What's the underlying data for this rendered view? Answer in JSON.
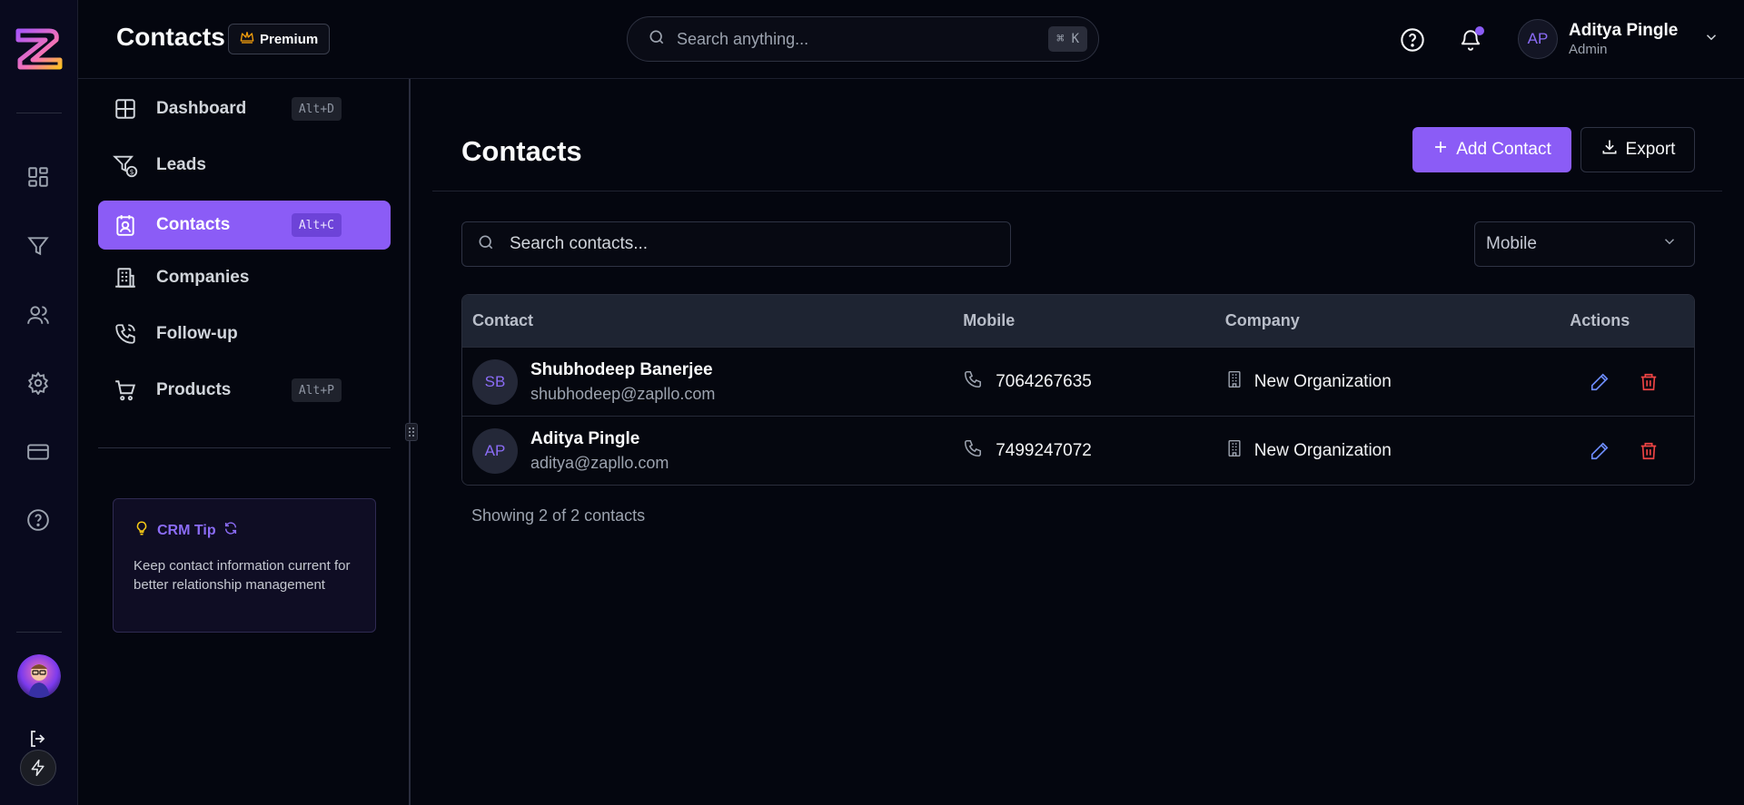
{
  "header": {
    "title": "Contacts",
    "premium_label": "Premium",
    "search_placeholder": "Search anything...",
    "search_shortcut_symbol": "⌘",
    "search_shortcut_key": "K",
    "user": {
      "initials": "AP",
      "name": "Aditya Pingle",
      "role": "Admin"
    }
  },
  "rail": {
    "icons": [
      "dashboard-icon",
      "funnel-icon",
      "users-icon",
      "gear-icon",
      "card-icon",
      "help-icon"
    ],
    "footer_icons": [
      "logout-icon",
      "bolt-icon"
    ]
  },
  "sidebar": {
    "items": [
      {
        "label": "Dashboard",
        "shortcut": "Alt+D",
        "icon": "grid-icon"
      },
      {
        "label": "Leads",
        "shortcut": "",
        "icon": "funnel-dollar-icon"
      },
      {
        "label": "Contacts",
        "shortcut": "Alt+C",
        "icon": "contact-card-icon",
        "active": true
      },
      {
        "label": "Companies",
        "shortcut": "",
        "icon": "building-icon"
      },
      {
        "label": "Follow-up",
        "shortcut": "",
        "icon": "phone-call-icon"
      },
      {
        "label": "Products",
        "shortcut": "Alt+P",
        "icon": "cart-icon"
      }
    ],
    "tip": {
      "title": "CRM Tip",
      "body": "Keep contact information current for better relationship management"
    }
  },
  "main": {
    "title": "Contacts",
    "add_label": "Add Contact",
    "export_label": "Export",
    "search_placeholder": "Search contacts...",
    "filter_value": "Mobile",
    "table": {
      "columns": [
        "Contact",
        "Mobile",
        "Company",
        "Actions"
      ],
      "rows": [
        {
          "initials": "SB",
          "name": "Shubhodeep Banerjee",
          "email": "shubhodeep@zapllo.com",
          "mobile": "7064267635",
          "company": "New Organization"
        },
        {
          "initials": "AP",
          "name": "Aditya Pingle",
          "email": "aditya@zapllo.com",
          "mobile": "7499247072",
          "company": "New Organization"
        }
      ]
    },
    "footer": "Showing 2 of 2 contacts"
  },
  "colors": {
    "accent": "#8b5cf6",
    "background": "#04060f",
    "delete": "#ef4444",
    "edit": "#6d8cff",
    "tip_icon": "#facc15"
  }
}
